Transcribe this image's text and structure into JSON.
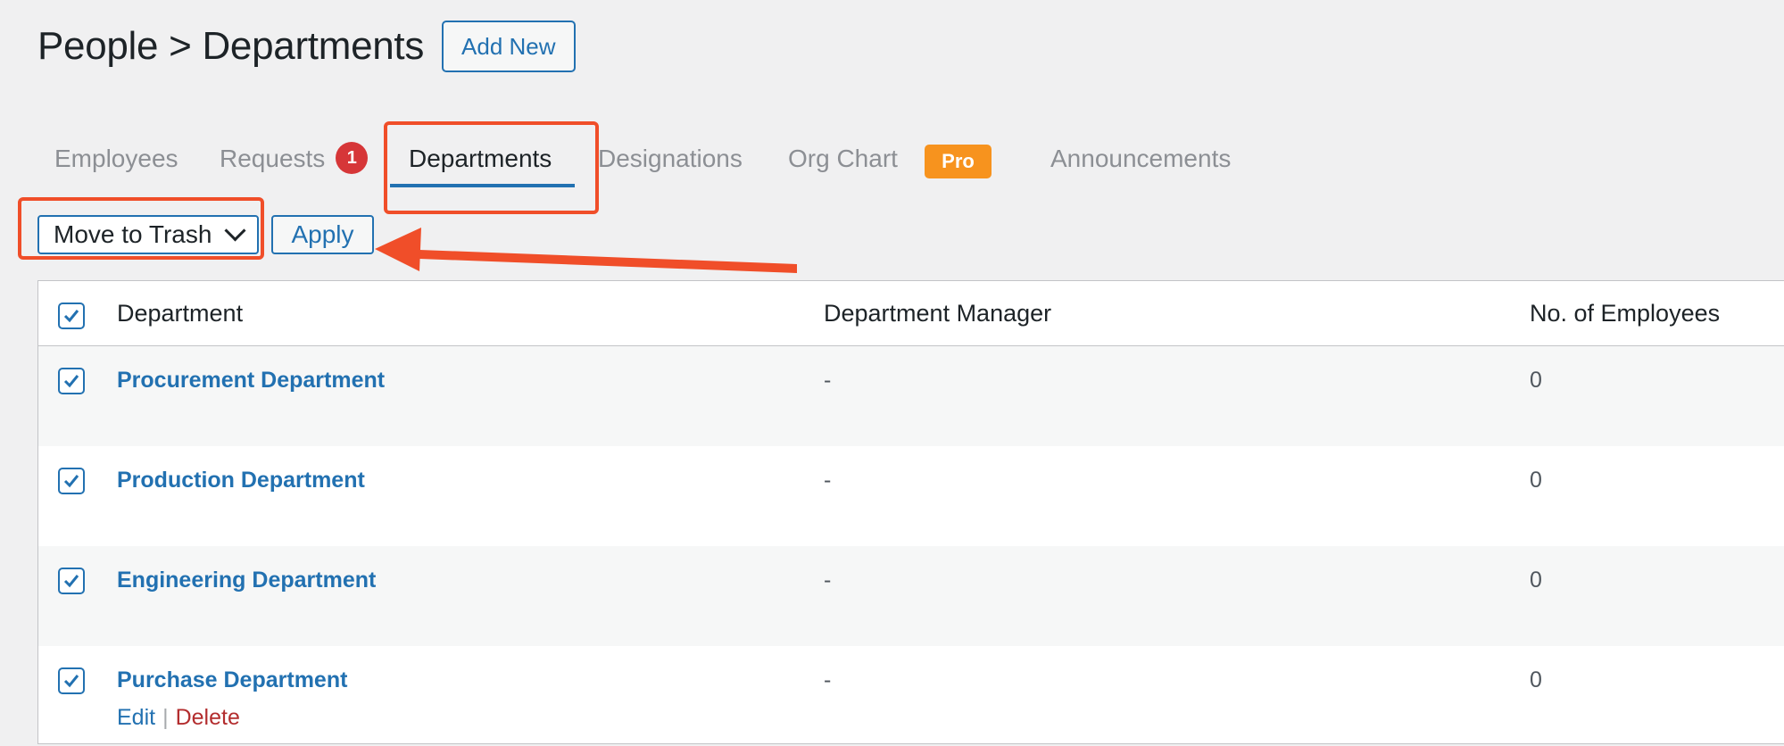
{
  "header": {
    "title": "People > Departments",
    "add_new_label": "Add New"
  },
  "tabs": [
    {
      "label": "Employees",
      "active": false
    },
    {
      "label": "Requests",
      "active": false,
      "badge": "1"
    },
    {
      "label": "Departments",
      "active": true
    },
    {
      "label": "Designations",
      "active": false
    },
    {
      "label": "Org Chart",
      "active": false,
      "badge": "Pro"
    },
    {
      "label": "Announcements",
      "active": false
    }
  ],
  "bulk_actions": {
    "selected": "Move to Trash",
    "apply_label": "Apply"
  },
  "table": {
    "columns": [
      "Department",
      "Department Manager",
      "No. of Employees"
    ],
    "rows": [
      {
        "department": "Procurement Department",
        "manager": "-",
        "employees": "0",
        "checked": true
      },
      {
        "department": "Production Department",
        "manager": "-",
        "employees": "0",
        "checked": true
      },
      {
        "department": "Engineering Department",
        "manager": "-",
        "employees": "0",
        "checked": true
      },
      {
        "department": "Purchase Department",
        "manager": "-",
        "employees": "0",
        "checked": true,
        "actions": {
          "edit": "Edit",
          "separator": "|",
          "delete": "Delete"
        }
      }
    ]
  },
  "colors": {
    "accent": "#2271b1",
    "annotation": "#f04e29",
    "badge_red": "#d63638",
    "pro_orange": "#f7931e",
    "delete_red": "#b32d2e"
  },
  "icons": {
    "bulk_dropdown": "chevron-down-icon",
    "checkbox": "checkmark-icon",
    "annotation_arrow": "arrow-icon"
  }
}
